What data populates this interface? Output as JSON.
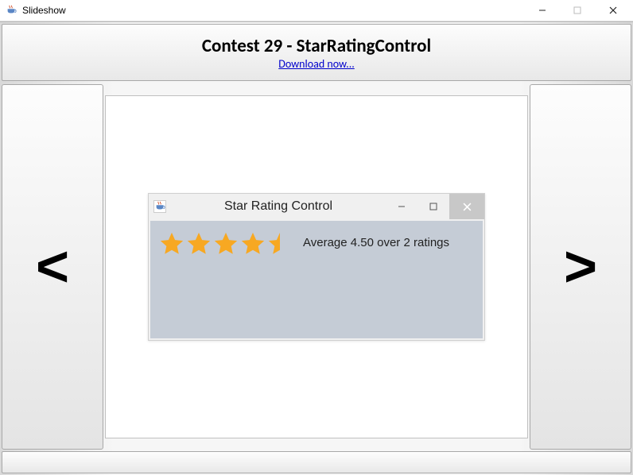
{
  "window": {
    "title": "Slideshow",
    "minimize": "—",
    "maximize": "☐",
    "close": "✕"
  },
  "header": {
    "title": "Contest 29 - StarRatingControl",
    "download_label": "Download now..."
  },
  "nav": {
    "prev": "<",
    "next": ">"
  },
  "inner_window": {
    "title": "Star Rating Control",
    "minimize": "—",
    "maximize": "☐",
    "close": "✕",
    "rating_value": 4.5,
    "rating_count": 2,
    "rating_text": "Average 4.50 over 2 ratings",
    "stars_full": 4,
    "stars_half": 1,
    "stars_empty": 0,
    "star_color_fill": "#f7a822",
    "star_color_empty": "#b8b8b8"
  }
}
